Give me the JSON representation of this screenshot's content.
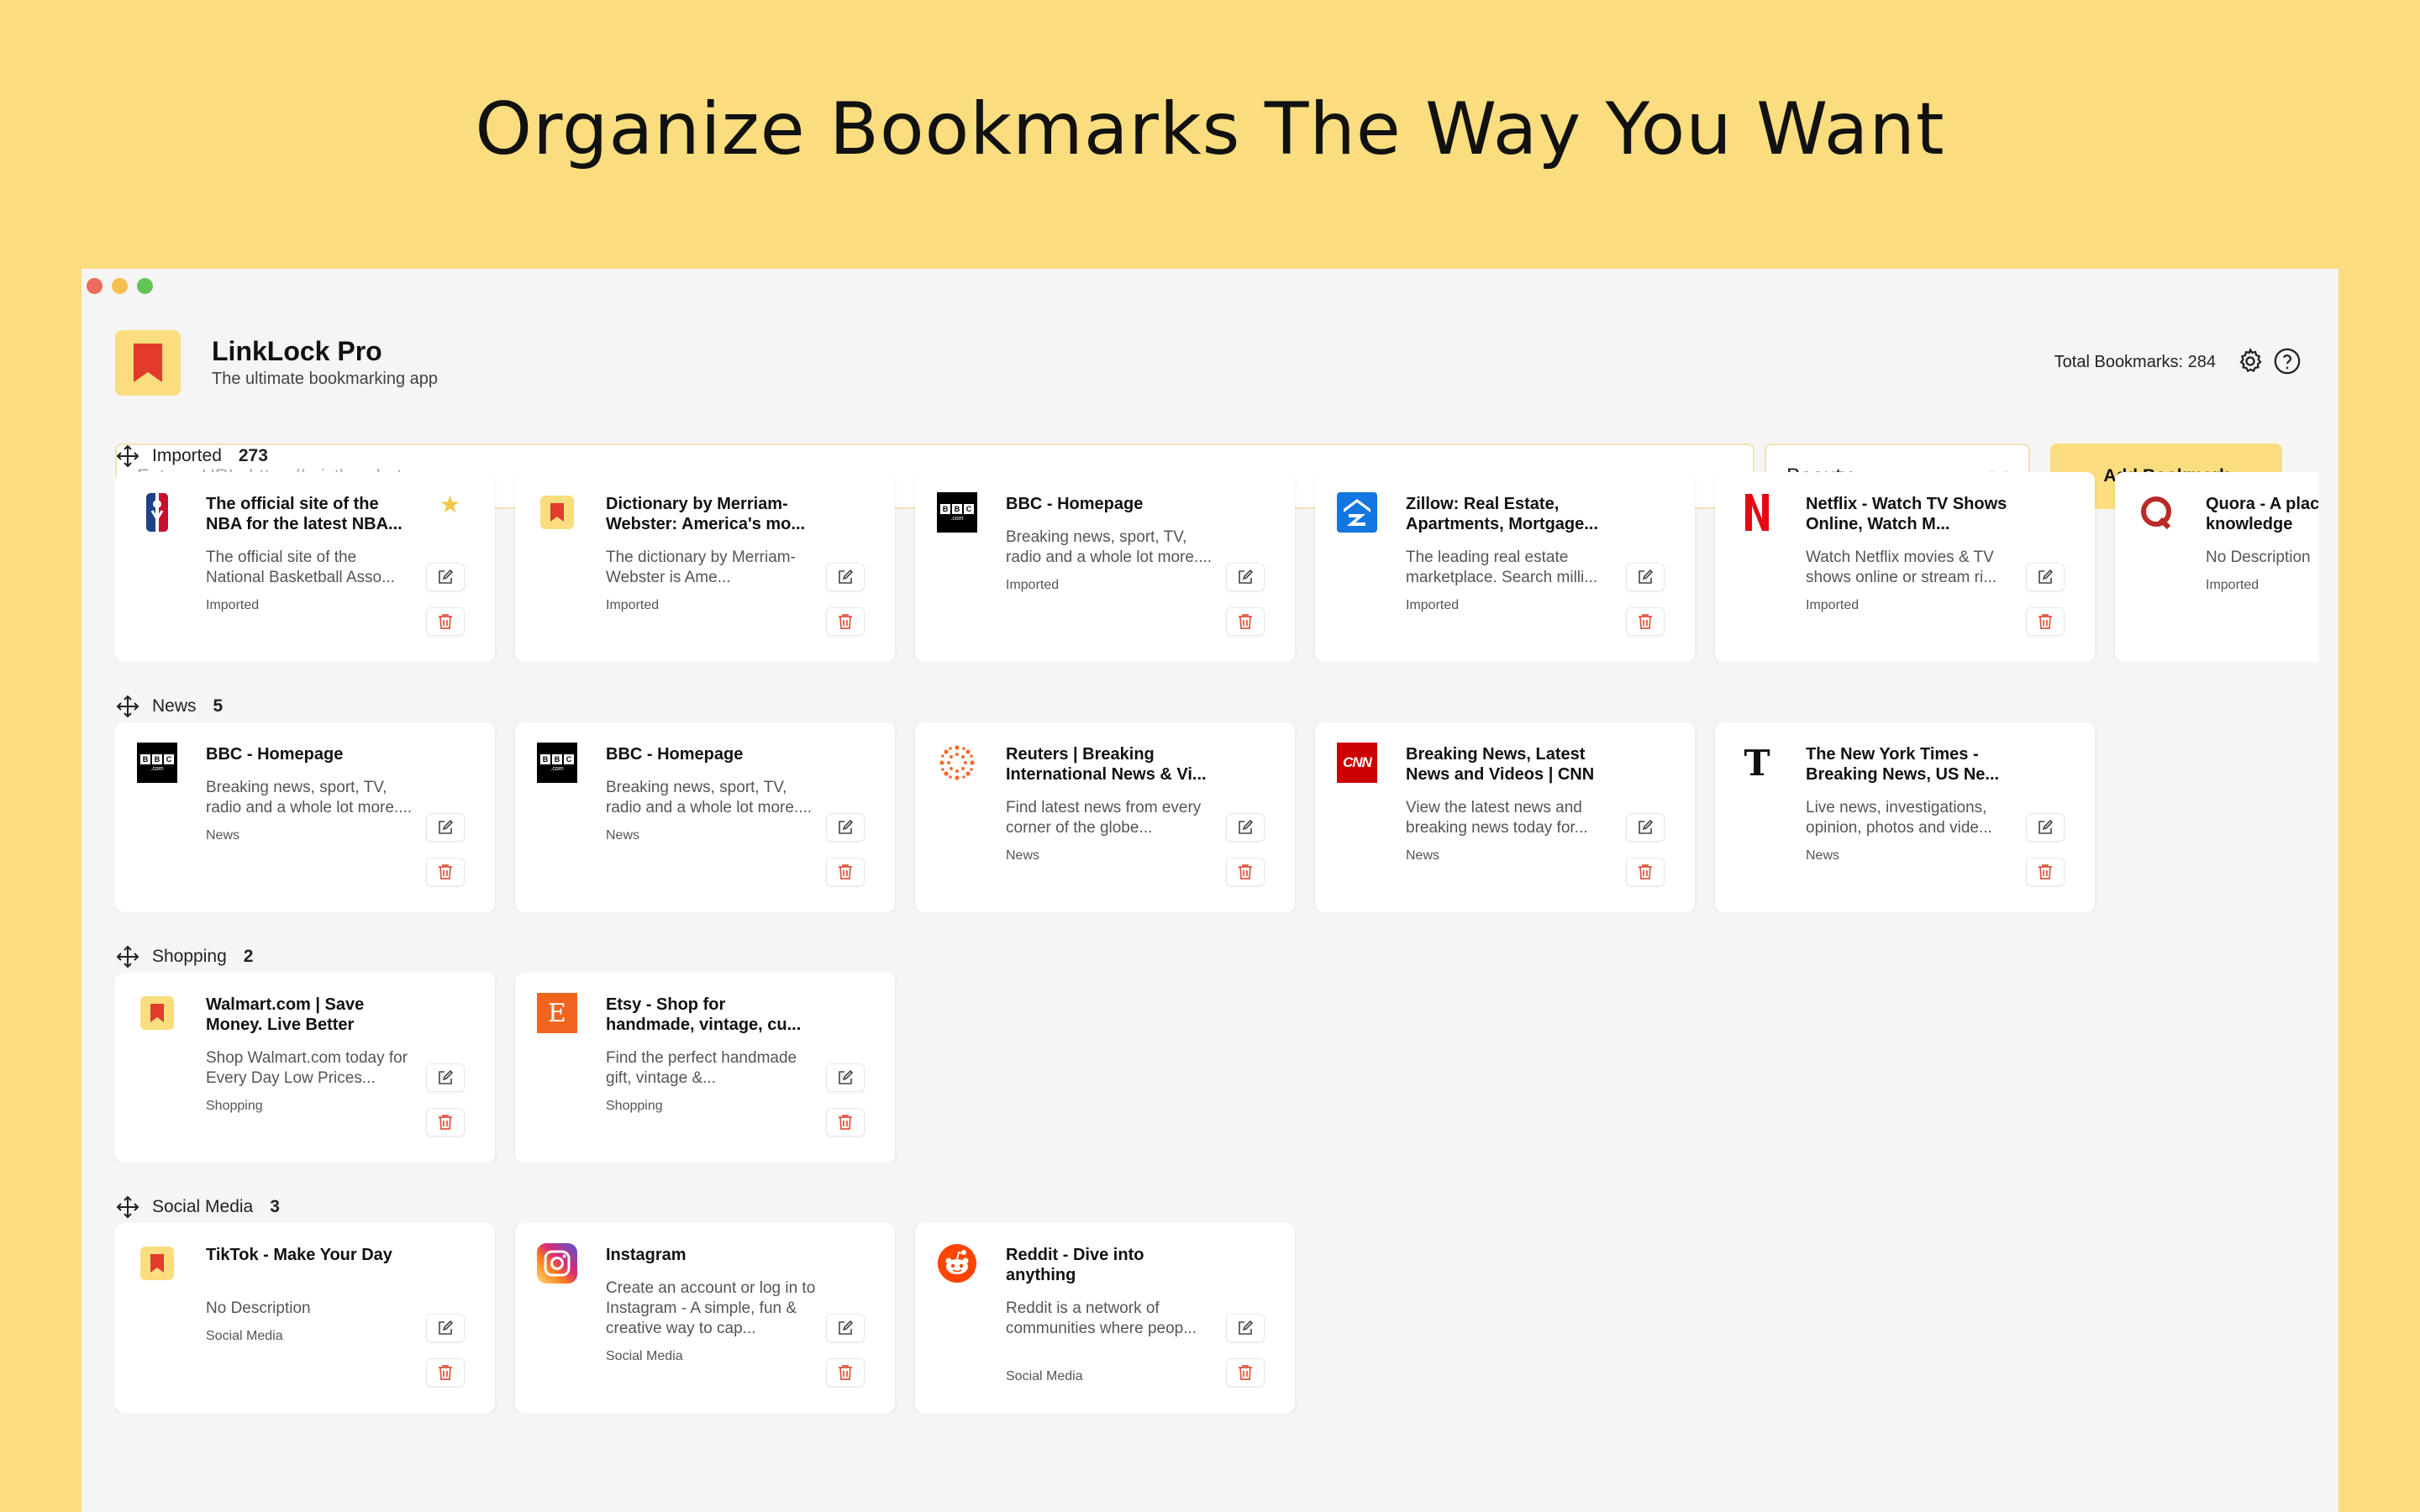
{
  "headline": "Organize Bookmarks The Way You Want",
  "app": {
    "title": "LinkLock Pro",
    "subtitle": "The ultimate bookmarking app"
  },
  "header": {
    "total_label": "Total Bookmarks: 284"
  },
  "form": {
    "url_placeholder": "Enter a URL: https://erictherobot.com",
    "url_value": "",
    "category_selected": "Beauty",
    "add_label": "Add Bookmark"
  },
  "colors": {
    "accent": "#f9dd7e",
    "delete": "#e0533f",
    "background": "#f5f5f5"
  },
  "sections": [
    {
      "name": "Imported",
      "count": "273",
      "cards": [
        {
          "title": "The official site of the NBA for the latest NBA...",
          "desc": "The official site of the National Basketball Asso...",
          "category": "Imported",
          "icon": "nba-icon",
          "starred": true
        },
        {
          "title": "Dictionary by Merriam-Webster: America's mo...",
          "desc": "The dictionary by Merriam-Webster is Ame...",
          "category": "Imported",
          "icon": "bookmark-icon",
          "starred": false
        },
        {
          "title": "BBC - Homepage",
          "desc": "Breaking news, sport, TV, radio and a whole lot more....",
          "category": "Imported",
          "icon": "bbc-icon",
          "starred": false
        },
        {
          "title": "Zillow: Real Estate, Apartments, Mortgage...",
          "desc": "The leading real estate marketplace. Search milli...",
          "category": "Imported",
          "icon": "zillow-icon",
          "starred": false
        },
        {
          "title": "Netflix - Watch TV Shows Online, Watch M...",
          "desc": "Watch Netflix movies & TV shows online or stream ri...",
          "category": "Imported",
          "icon": "netflix-icon",
          "starred": false
        },
        {
          "title": "Quora - A place to share knowledge",
          "desc": "No Description",
          "category": "Imported",
          "icon": "quora-icon",
          "starred": false
        }
      ]
    },
    {
      "name": "News",
      "count": "5",
      "cards": [
        {
          "title": "BBC - Homepage",
          "desc": "Breaking news, sport, TV, radio and a whole lot more....",
          "category": "News",
          "icon": "bbc-icon",
          "starred": false
        },
        {
          "title": "BBC - Homepage",
          "desc": "Breaking news, sport, TV, radio and a whole lot more....",
          "category": "News",
          "icon": "bbc-icon",
          "starred": false
        },
        {
          "title": "Reuters | Breaking International News & Vi...",
          "desc": "Find latest news from every corner of the globe...",
          "category": "News",
          "icon": "reuters-icon",
          "starred": false
        },
        {
          "title": "Breaking News, Latest News and Videos | CNN",
          "desc": "View the latest news and breaking news today for...",
          "category": "News",
          "icon": "cnn-icon",
          "starred": false
        },
        {
          "title": "The New York Times - Breaking News, US Ne...",
          "desc": "Live news, investigations, opinion, photos and vide...",
          "category": "News",
          "icon": "nyt-icon",
          "starred": false
        }
      ]
    },
    {
      "name": "Shopping",
      "count": "2",
      "cards": [
        {
          "title": "Walmart.com | Save Money. Live Better",
          "desc": "Shop Walmart.com today for Every Day Low Prices...",
          "category": "Shopping",
          "icon": "bookmark-icon",
          "starred": false
        },
        {
          "title": "Etsy - Shop for handmade, vintage, cu...",
          "desc": "Find the perfect handmade gift, vintage &...",
          "category": "Shopping",
          "icon": "etsy-icon",
          "starred": false
        }
      ]
    },
    {
      "name": "Social Media",
      "count": "3",
      "cards": [
        {
          "title": "TikTok - Make Your Day",
          "desc": "No Description",
          "category": "Social Media",
          "icon": "bookmark-icon",
          "starred": false
        },
        {
          "title": "Instagram",
          "desc": "Create an account or log in to Instagram - A simple, fun & creative way to cap...",
          "category": "Social Media",
          "icon": "instagram-icon",
          "starred": false
        },
        {
          "title": "Reddit - Dive into anything",
          "desc": "Reddit is a network of communities where peop...",
          "category": "Social Media",
          "icon": "reddit-icon",
          "starred": false
        }
      ]
    }
  ]
}
